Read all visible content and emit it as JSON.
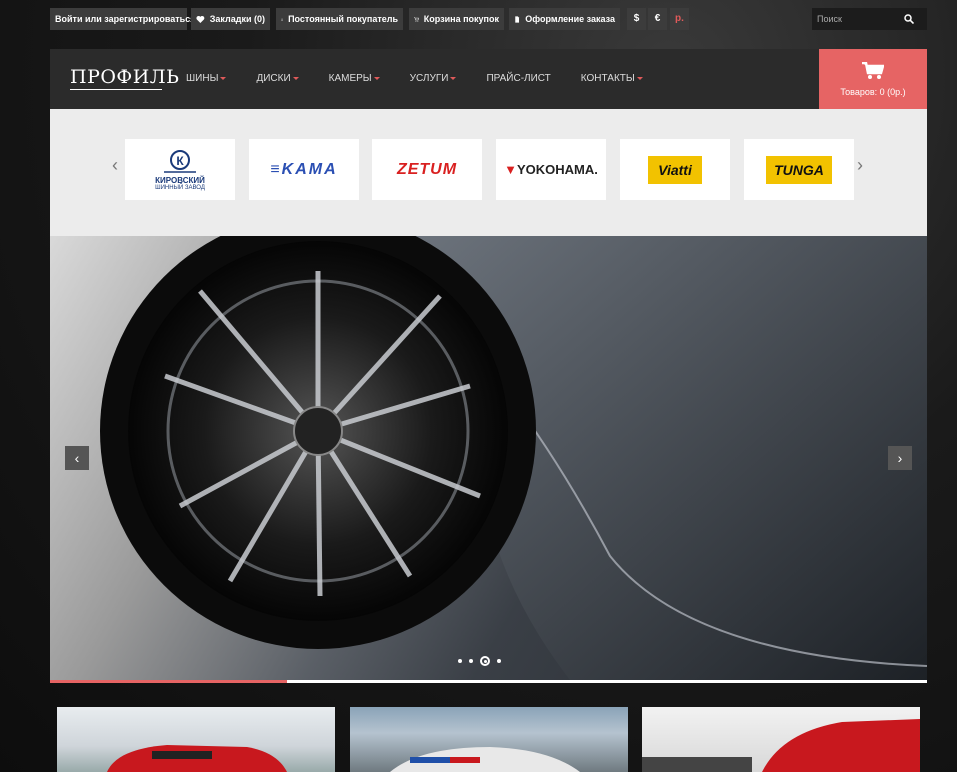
{
  "topbar": {
    "login": "Войти или зарегистрироваться",
    "bookmarks": "Закладки (0)",
    "customer": "Постоянный покупатель",
    "cart": "Корзина покупок",
    "checkout": "Оформление заказа",
    "currencies": [
      "$",
      "€",
      "р."
    ],
    "active_currency": "р.",
    "search_placeholder": "Поиск"
  },
  "header": {
    "logo": "ПРОФИЛЬ",
    "nav": [
      {
        "label": "ШИНЫ",
        "dropdown": true
      },
      {
        "label": "ДИСКИ",
        "dropdown": true
      },
      {
        "label": "КАМЕРЫ",
        "dropdown": true
      },
      {
        "label": "УСЛУГИ",
        "dropdown": true
      },
      {
        "label": "ПРАЙС-ЛИСТ",
        "dropdown": false
      },
      {
        "label": "КОНТАКТЫ",
        "dropdown": true
      }
    ],
    "cart_text": "Товаров: 0 (0р.)"
  },
  "brands": {
    "prev": "‹",
    "next": "›",
    "items": [
      {
        "name": "КИРОВСКИЙ",
        "sub": "ШИННЫЙ ЗАВОД"
      },
      {
        "name": "KAMA"
      },
      {
        "name": "ZETUM"
      },
      {
        "name": "YOKOHAMA."
      },
      {
        "name": "Viatti"
      },
      {
        "name": "TUNGA"
      }
    ]
  },
  "slider": {
    "prev": "‹",
    "next": "›",
    "slides": 4,
    "active_slide": 3,
    "progress": 0.27
  },
  "colors": {
    "accent": "#e66464",
    "topbar_bg": "#3c3c3c",
    "header_bg": "#2b2b2b",
    "brands_bg": "#ececec"
  }
}
